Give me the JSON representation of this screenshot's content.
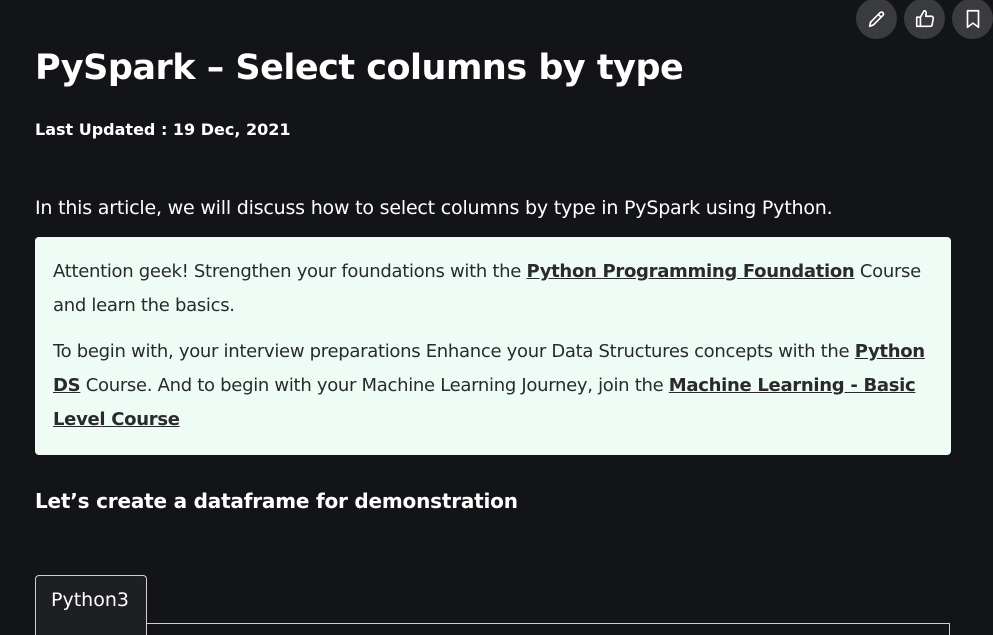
{
  "actions": {
    "edit_icon": "pencil-icon",
    "like_icon": "thumbs-up-icon",
    "bookmark_icon": "bookmark-icon"
  },
  "article": {
    "title": "PySpark – Select columns by type",
    "last_updated": "Last Updated : 19 Dec, 2021",
    "intro": "In this article, we will discuss how to select columns by type in PySpark using Python.",
    "subheading": "Let’s create a dataframe for demonstration"
  },
  "callout": {
    "p1_before": " Attention geek! Strengthen your foundations with the ",
    "p1_link": "Python Programming Foundation",
    "p1_after": " Course and learn the basics.",
    "p2_before": "To begin with, your interview preparations Enhance your Data Structures concepts with the ",
    "p2_link1": "Python DS",
    "p2_middle": " Course. And to begin with your Machine Learning Journey, join the ",
    "p2_link2": "Machine Learning - Basic Level Course"
  },
  "code": {
    "tab_label": "Python3"
  },
  "colors": {
    "background": "#131417",
    "callout_bg": "#effcf6",
    "action_btn_bg": "#3a3b3f"
  }
}
